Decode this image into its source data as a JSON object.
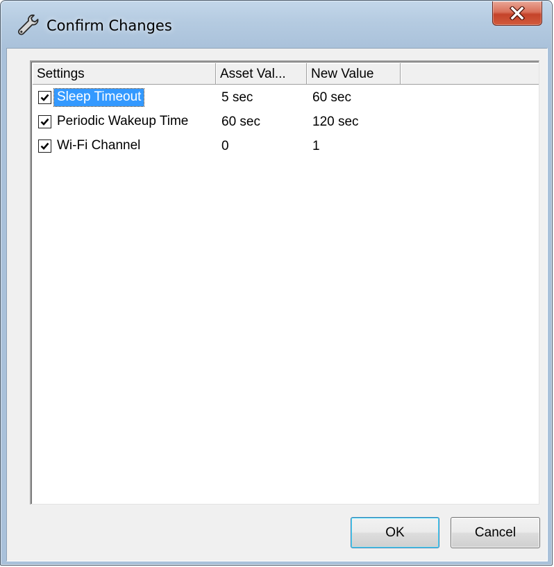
{
  "window": {
    "title": "Confirm Changes",
    "title_icon": "wrench-icon",
    "close_icon": "close-icon"
  },
  "table": {
    "columns": [
      "Settings",
      "Asset Val...",
      "New Value",
      ""
    ],
    "rows": [
      {
        "checked": true,
        "selected": true,
        "setting": "Sleep Timeout",
        "asset_value": "5 sec",
        "new_value": "60 sec"
      },
      {
        "checked": true,
        "selected": false,
        "setting": "Periodic Wakeup Time",
        "asset_value": "60 sec",
        "new_value": "120 sec"
      },
      {
        "checked": true,
        "selected": false,
        "setting": "Wi-Fi Channel",
        "asset_value": "0",
        "new_value": "1"
      }
    ]
  },
  "buttons": {
    "ok_label": "OK",
    "cancel_label": "Cancel"
  },
  "colors": {
    "selection": "#3399ff",
    "close_button": "#c4432a"
  }
}
